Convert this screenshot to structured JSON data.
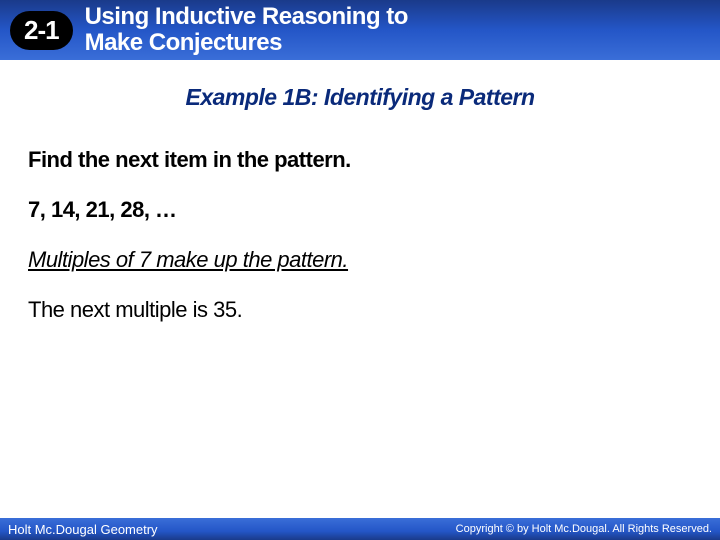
{
  "header": {
    "section_number": "2-1",
    "title_line1": "Using Inductive Reasoning to",
    "title_line2": "Make Conjectures"
  },
  "example": {
    "heading": "Example 1B: Identifying a Pattern",
    "instruction": "Find the next item in the pattern.",
    "sequence": "7, 14, 21, 28, …",
    "observation": "Multiples of 7 make up the pattern.",
    "answer": "The next multiple is 35."
  },
  "footer": {
    "left": "Holt Mc.Dougal Geometry",
    "right": "Copyright © by Holt Mc.Dougal. All Rights Reserved."
  }
}
